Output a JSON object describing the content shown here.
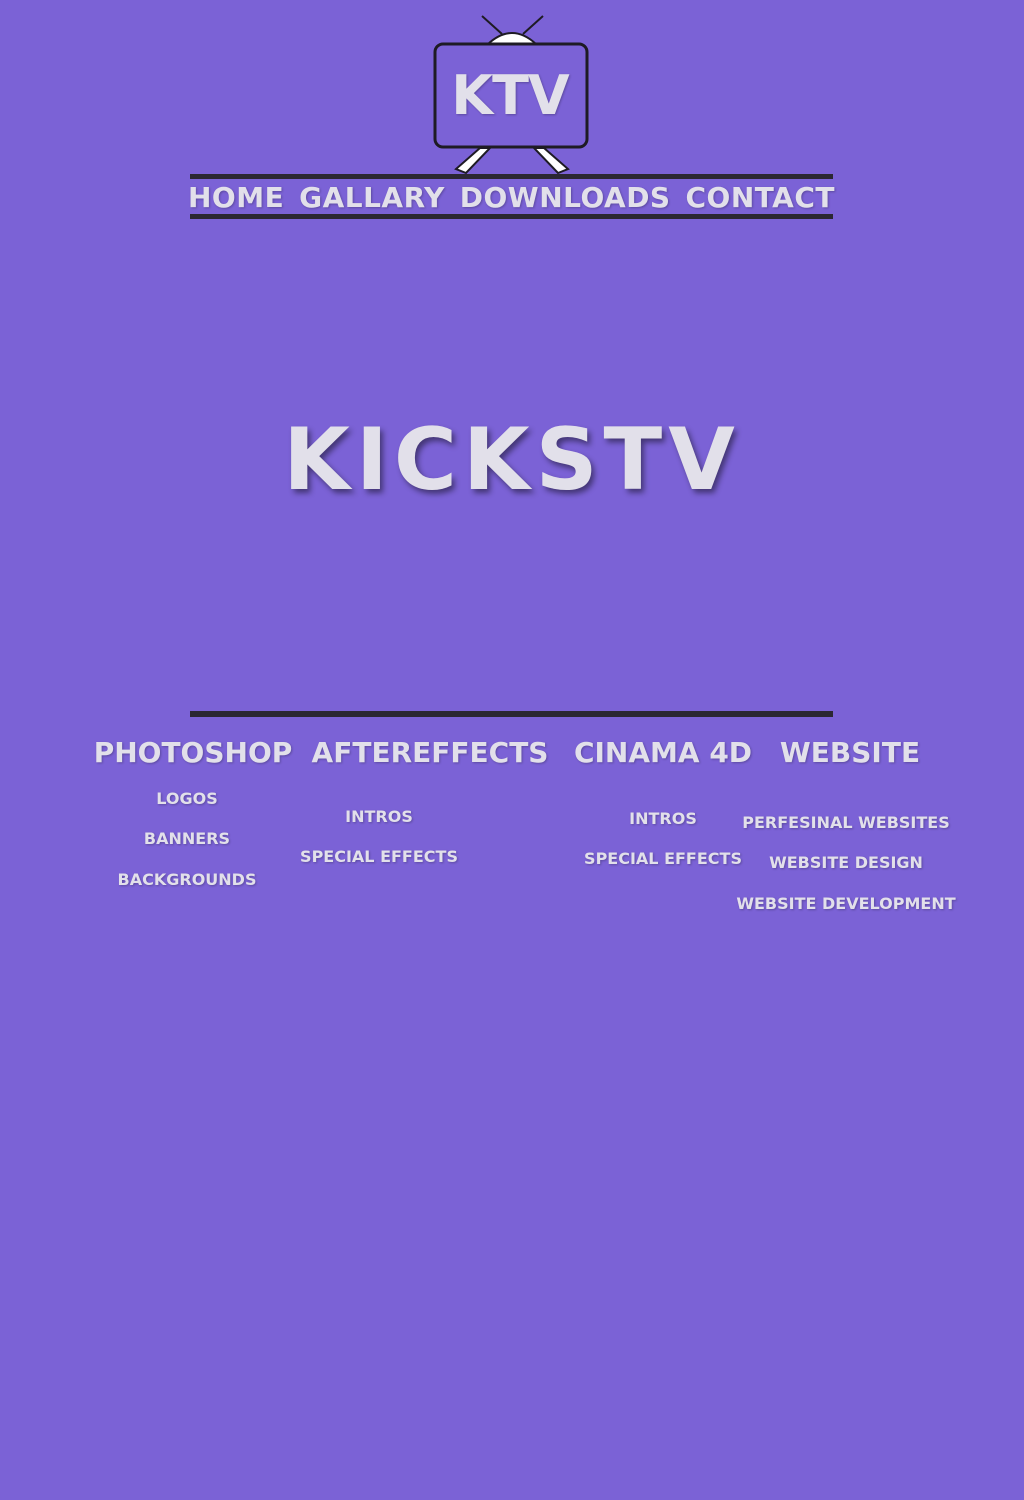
{
  "logo": {
    "text": "KTV",
    "icon": "tv-icon"
  },
  "nav": {
    "items": [
      {
        "label": "HOME"
      },
      {
        "label": "GALLARY"
      },
      {
        "label": "DOWNLOADS"
      },
      {
        "label": "CONTACT"
      }
    ]
  },
  "hero": {
    "title": "KICKSTV"
  },
  "categories": [
    {
      "title": "PHOTOSHOP",
      "items": [
        "LOGOS",
        "BANNERS",
        "BACKGROUNDS"
      ]
    },
    {
      "title": "AFTEREFFECTS",
      "items": [
        "INTROS",
        "SPECIAL EFFECTS"
      ]
    },
    {
      "title": "CINAMA 4D",
      "items": [
        "INTROS",
        "SPECIAL EFFECTS"
      ]
    },
    {
      "title": "WEBSITE",
      "items": [
        "PERFESINAL WEBSITES",
        "WEBSITE DESIGN",
        "WEBSITE DEVELOPMENT"
      ]
    }
  ],
  "colors": {
    "background": "#7b62d6",
    "text": "#e2e0ea",
    "lines": "#2b2733"
  }
}
